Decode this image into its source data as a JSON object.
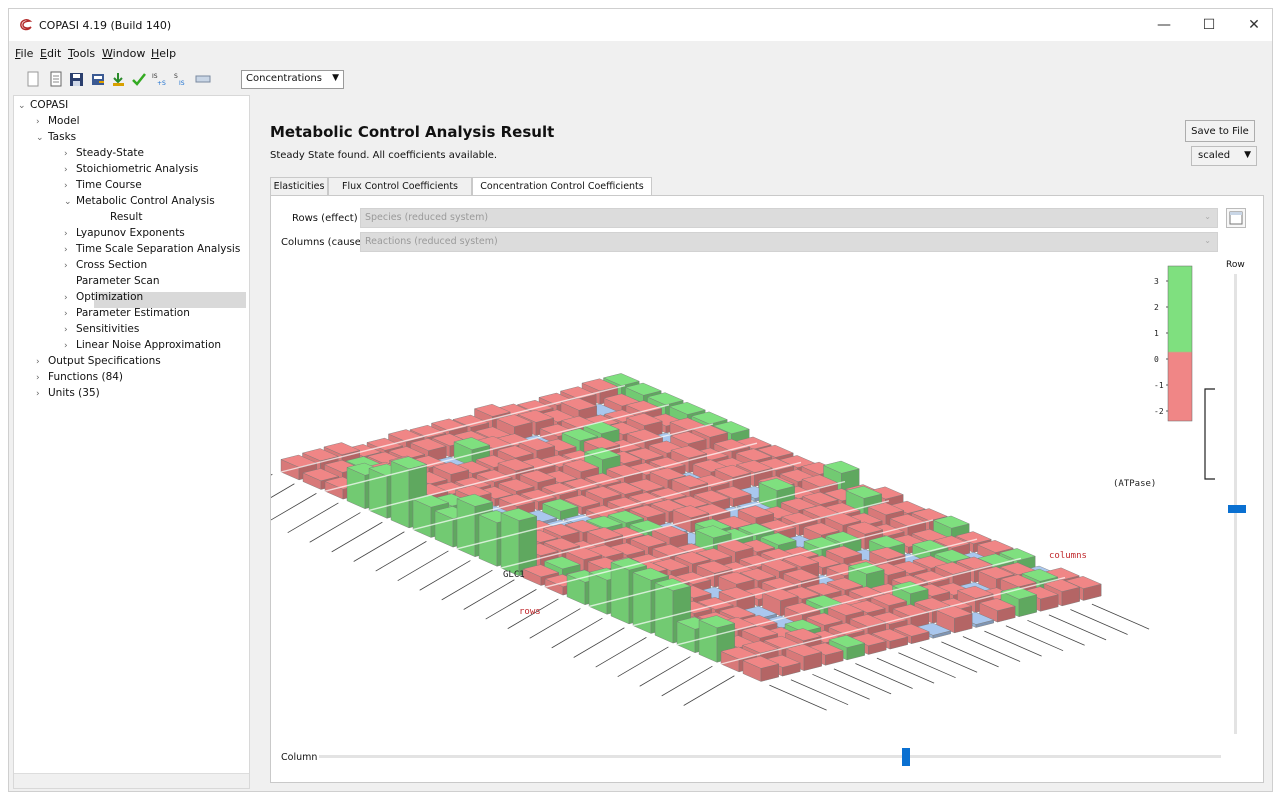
{
  "window": {
    "title": "COPASI 4.19 (Build 140)",
    "controls": {
      "minimize": "—",
      "maximize": "☐",
      "close": "✕"
    }
  },
  "menu": [
    {
      "label": "File",
      "key": "F",
      "rest": "ile"
    },
    {
      "label": "Edit",
      "key": "E",
      "rest": "dit"
    },
    {
      "label": "Tools",
      "key": "T",
      "rest": "ools"
    },
    {
      "label": "Window",
      "key": "W",
      "rest": "indow"
    },
    {
      "label": "Help",
      "key": "H",
      "rest": "elp"
    }
  ],
  "toolbar": {
    "icons": [
      "new-file-icon",
      "open-icon",
      "save-icon",
      "export-sbml-icon",
      "import-icon",
      "check-icon",
      "convert-to-irreversible-icon",
      "slider-icon",
      "ruler-icon"
    ],
    "combo_value": "Concentrations"
  },
  "tree": {
    "items": [
      {
        "label": "COPASI",
        "expander": "⌄",
        "bold": false
      },
      {
        "label": "Model",
        "expander": "›"
      },
      {
        "label": "Tasks",
        "expander": "⌄"
      },
      {
        "label": "Steady-State",
        "expander": "›"
      },
      {
        "label": "Stoichiometric Analysis",
        "expander": "›"
      },
      {
        "label": "Time Course",
        "expander": "›"
      },
      {
        "label": "Metabolic Control Analysis",
        "expander": "⌄"
      },
      {
        "label": "Result",
        "expander": ""
      },
      {
        "label": "Lyapunov Exponents",
        "expander": "›"
      },
      {
        "label": "Time Scale Separation Analysis",
        "expander": "›"
      },
      {
        "label": "Cross Section",
        "expander": "›"
      },
      {
        "label": "Parameter Scan",
        "expander": ""
      },
      {
        "label": "Optimization",
        "expander": "›"
      },
      {
        "label": "Parameter Estimation",
        "expander": "›"
      },
      {
        "label": "Sensitivities",
        "expander": "›"
      },
      {
        "label": "Linear Noise Approximation",
        "expander": "›"
      },
      {
        "label": "Output Specifications",
        "expander": "›"
      },
      {
        "label": "Functions (84)",
        "expander": "›"
      },
      {
        "label": "Units (35)",
        "expander": "›"
      }
    ]
  },
  "main": {
    "title": "Metabolic Control Analysis Result",
    "status": "Steady State found. All coefficients available.",
    "save_button": "Save to File",
    "scale_combo": "scaled",
    "tabs": [
      "Elasticities",
      "Flux Control Coefficients",
      "Concentration Control Coefficients"
    ],
    "active_tab": 2,
    "rows_label": "Rows (effect)",
    "rows_value": "Species (reduced system)",
    "cols_label": "Columns (cause)",
    "cols_value": "Reactions (reduced system)",
    "row_slider_label": "Row",
    "column_slider_label": "Column",
    "row_slider_pos": 0.5,
    "column_slider_pos": 0.65
  },
  "plot3d": {
    "legend_ticks": [
      "3",
      "2",
      "1",
      "0",
      "-1",
      "-2"
    ],
    "axis_labels": {
      "rows": "rows",
      "columns": "columns"
    },
    "marker_labels": {
      "row": "GLC1",
      "column": "(ATPase)"
    },
    "colors": {
      "positive": "#7fe07f",
      "negative": "#f08686",
      "near_zero": "#a9c7ee",
      "axis_text": "#c0282c"
    }
  }
}
